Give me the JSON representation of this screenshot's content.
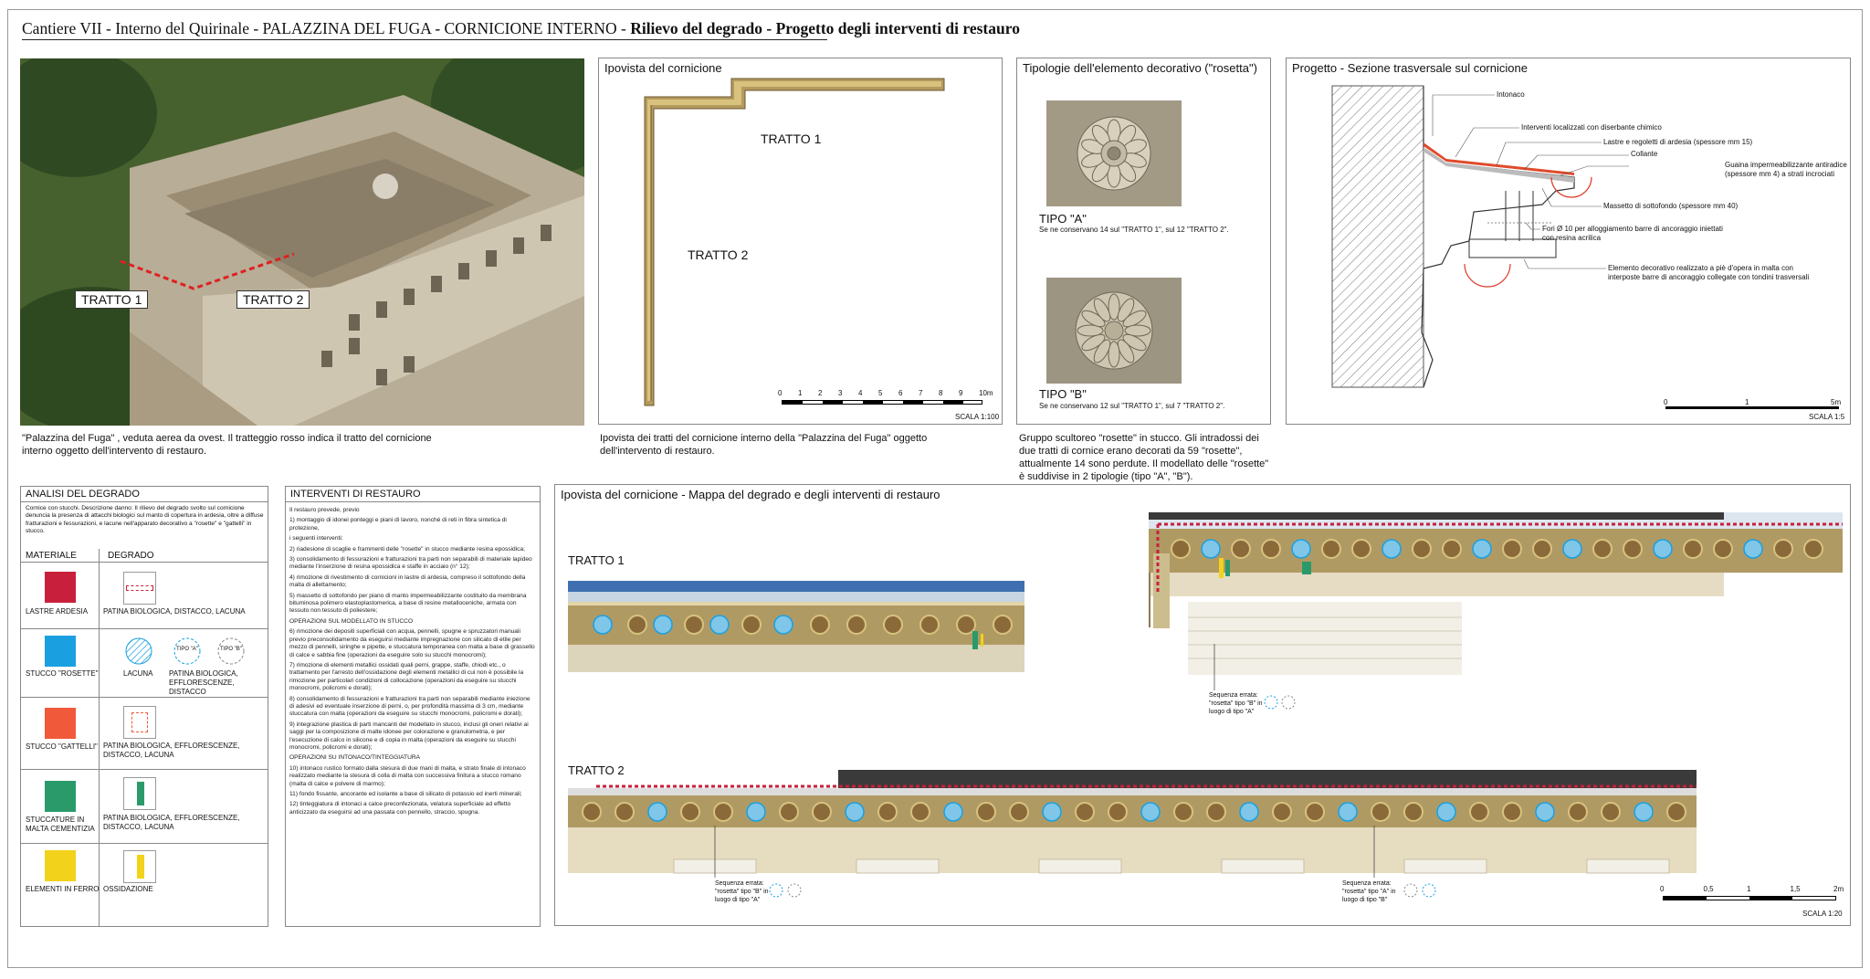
{
  "header": {
    "title_part1": "Cantiere VII - Interno del Quirinale - PALAZZINA DEL FUGA - CORNICIONE INTERNO - ",
    "title_part2": "Rilievo del degrado - Progetto degli interventi di restauro"
  },
  "aerial": {
    "label1": "TRATTO 1",
    "label2": "TRATTO 2",
    "caption": "\"Palazzina del Fuga\" , veduta aerea da ovest. Il tratteggio rosso indica il tratto del cornicione interno oggetto dell'intervento di restauro."
  },
  "ipovista": {
    "title": "Ipovista del cornicione",
    "label1": "TRATTO 1",
    "label2": "TRATTO 2",
    "scale_ticks": [
      "0",
      "1",
      "2",
      "3",
      "4",
      "5",
      "6",
      "7",
      "8",
      "9",
      "10m"
    ],
    "scale_label": "SCALA 1:100",
    "caption": "Ipovista dei tratti del cornicione interno della \"Palazzina del Fuga\" oggetto dell'intervento di restauro."
  },
  "tipologie": {
    "title": "Tipologie dell'elemento decorativo (\"rosetta\")",
    "tipo_a": "TIPO \"A\"",
    "tipo_a_note": "Se ne conservano 14 sul \"TRATTO 1\", sul 12 \"TRATTO 2\".",
    "tipo_b": "TIPO \"B\"",
    "tipo_b_note": "Se ne conservano 12 sul \"TRATTO 1\", sul 7 \"TRATTO 2\".",
    "caption": "Gruppo scultoreo \"rosette\" in stucco. Gli intradossi dei due tratti di cornice erano decorati da 59 \"rosette\", attualmente 14 sono perdute. Il modellato delle \"rosette\" è suddivise in 2 tipologie (tipo \"A\", \"B\")."
  },
  "progetto": {
    "title": "Progetto - Sezione trasversale sul cornicione",
    "labels": [
      "Intonaco",
      "Interventi localizzati con diserbante chimico",
      "Lastre e regoletti di ardesia (spessore mm 15)",
      "Collante",
      "Guaina impermeabilizzante antiradice (spessore mm 4) a strati incrociati",
      "Massetto di sottofondo (spessore mm 40)",
      "Fori Ø 10 per alloggiamento barre di ancoraggio iniettati con resina acrilica",
      "Elemento decorativo realizzato a piè d'opera in malta con interposte barre di ancoraggio collegate con tondini trasversali"
    ],
    "scale_ticks": [
      "0",
      "1",
      "5m"
    ],
    "scale_label": "SCALA 1:5"
  },
  "analisi": {
    "title": "ANALISI DEL DEGRADO",
    "description": "Cornice con stucchi. Descrizione danno: Il rilievo del degrado svolto sul cornicione denuncia la presenza di attacchi biologici sul manto di copertura in ardesia, oltre a diffuse fratturazioni e fessurazioni, e lacune nell'apparato decorativo a \"rosette\" e \"gattelli\" in stucco.",
    "col_materiale": "MATERIALE",
    "col_degrado": "DEGRADO",
    "rows": [
      {
        "materiale": "LASTRE ARDESIA",
        "color": "#c8203c",
        "degrado": "PATINA BIOLOGICA, DISTACCO, LACUNA"
      },
      {
        "materiale": "STUCCO \"ROSETTE\"",
        "color": "#1aa0e0",
        "degrado_a": "LACUNA",
        "degrado_b": "PATINA BIOLOGICA, EFFLORESCENZE, DISTACCO",
        "tipo_a": "TIPO \"A\"",
        "tipo_b": "TIPO \"B\""
      },
      {
        "materiale": "STUCCO \"GATTELLI\"",
        "color": "#f05a3a",
        "degrado": "PATINA BIOLOGICA, EFFLORESCENZE, DISTACCO, LACUNA"
      },
      {
        "materiale": "STUCCATURE IN MALTA CEMENTIZIA",
        "color": "#2a9a6a",
        "degrado": "PATINA BIOLOGICA, EFFLORESCENZE, DISTACCO, LACUNA"
      },
      {
        "materiale": "ELEMENTI IN FERRO",
        "color": "#f2d21a",
        "degrado": "OSSIDAZIONE"
      }
    ]
  },
  "interventi": {
    "title": "INTERVENTI DI RESTAURO",
    "paragraphs": [
      "Il restauro prevede, previo",
      "1) montaggio di idonei ponteggi e piani di lavoro, nonché di reti in fibra sintetica di protezione,",
      "i seguenti interventi:",
      "2) riadesione di scaglie e frammenti delle \"rosette\" in stucco mediante resina epossidica;",
      "3) consolidamento di fessurazioni e fratturazioni tra parti non separabili di materiale lapideo mediante l'inserzione di resina epossidica e staffe in acciaio (n° 12);",
      "4) rimozione di rivestimento di cornicioni in lastre di ardesia, compreso il sottofondo della malta di allettamento;",
      "5) massetto di sottofondo per piano di manto impermeabilizzante costituito da membrana bituminosa polimero elastoplastomerica, a base di resine metalloceniche, armata con tessuto non tessuto di poliestere;",
      "OPERAZIONI SUL MODELLATO IN STUCCO",
      "6) rimozione dei depositi superficiali con acqua, pennelli, spugne e spruzzatori manuali previo preconsolidamento da eseguirsi mediante impregnazione con silicato di etile per mezzo di pennelli, siringhe e pipette, e stuccatura temporanea con malta a base di grassello di calce e sabbia fine (operazioni da eseguire solo su stucchi monocromi);",
      "7) rimozione di elementi metallici ossidati quali perni, grappe, staffe, chiodi etc., o trattamento per l'arresto dell'ossidazione degli elementi metallici di cui non è possibile la rimozione per particolari condizioni di collocazione (operazioni da eseguire su stucchi monocromi, policromi e dorati);",
      "8) consolidamento di fessurazioni e fratturazioni tra parti non separabili mediante iniezione di adesivi ed eventuale inserzione di perni, o, per profondità massima di 3 cm, mediante stuccatura con malta (operazioni da eseguire su stucchi monocromi, policromi e dorati);",
      "9) integrazione plastica di parti mancanti del modellato in stucco, inclusi gli oneri relativi ai saggi per la composizione di malte idonee per colorazione e granulometria, e per l'esecuzione di calco in silicone e di copia in malta (operazioni da eseguire su stucchi monocromi, policromi e dorati);",
      "OPERAZIONI SU INTONACO/TINTEGGIATURA",
      "10) intonaco rustico formato dalla stesura di due mani di malta, e strato finale di intonaco realizzato mediante la stesura di colla di malta con successiva finitura a stucco romano (malta di calce e polvere di marmo);",
      "11) fondo fissante, ancorante ed isolante a base di silicato di potassio ed inerti minerali;",
      "12) tinteggiatura di intonaci a calce preconfezionata, velatura superficiale ad effetto anticizzato da eseguirsi ad una passata con pennello, straccio, spugna."
    ]
  },
  "mappa": {
    "title": "Ipovista del cornicione - Mappa del degrado e degli interventi di restauro",
    "tratto1": "TRATTO 1",
    "tratto2": "TRATTO 2",
    "note1": "Sequenza errata: \"rosetta\" tipo \"B\" in luogo di tipo \"A\"",
    "note2": "Sequenza errata: \"rosetta\" tipo \"B\" in luogo di tipo \"A\"",
    "note3": "Sequenza errata: \"rosetta\" tipo \"A\" in luogo di tipo \"B\"",
    "mini_a": "TIPO \"A\"",
    "mini_b": "TIPO \"B\"",
    "scale_ticks": [
      "0",
      "0,5",
      "1",
      "1,5",
      "2m"
    ],
    "scale_label": "SCALA 1:20"
  },
  "colors": {
    "ardesia": "#c8203c",
    "rosette": "#1aa0e0",
    "gattelli": "#f05a3a",
    "cementizia": "#2a9a6a",
    "ferro": "#f2d21a",
    "stone": "#b9a46a"
  }
}
